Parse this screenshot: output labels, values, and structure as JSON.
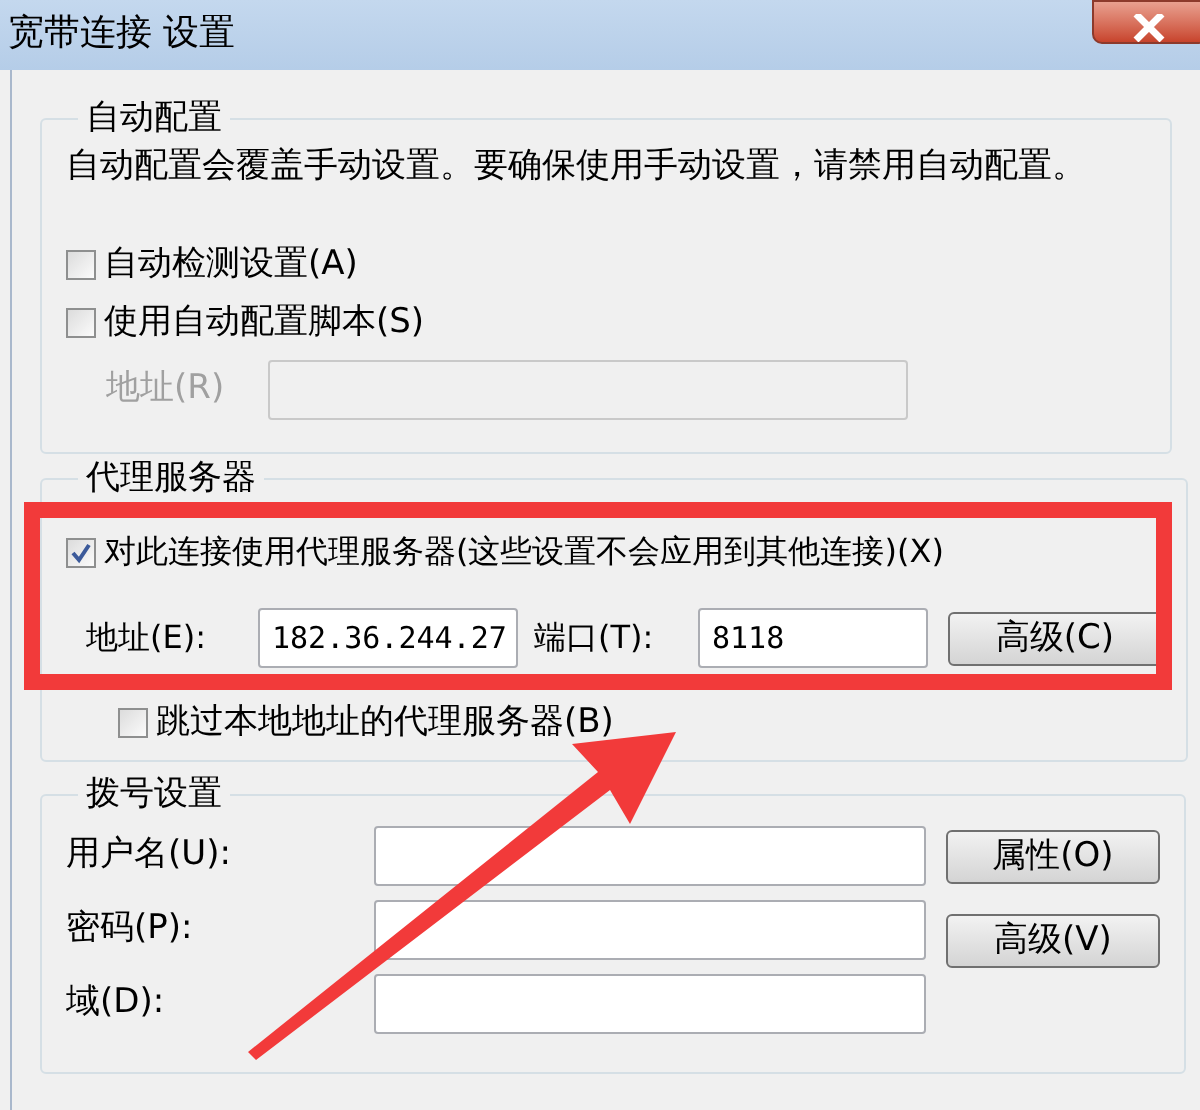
{
  "window": {
    "title": "宽带连接 设置"
  },
  "auto_config": {
    "title": "自动配置",
    "description": "自动配置会覆盖手动设置。要确保使用手动设置，请禁用自动配置。",
    "options": [
      {
        "label": "自动检测设置(A)",
        "checked": false
      },
      {
        "label": "使用自动配置脚本(S)",
        "checked": false
      }
    ],
    "address": {
      "label": "地址(R)",
      "disabled": true
    }
  },
  "proxy": {
    "title": "代理服务器",
    "use_proxy": {
      "label": "对此连接使用代理服务器(这些设置不会应用到其他连接)(X)",
      "checked": true
    },
    "address": {
      "label": "地址(E):",
      "value": "182.36.244.27"
    },
    "port": {
      "label": "端口(T):",
      "value": "8118"
    },
    "advanced_button": "高级(C)",
    "bypass_local": {
      "label": "跳过本地地址的代理服务器(B)",
      "checked": false
    }
  },
  "dialup": {
    "title": "拨号设置",
    "fields": [
      {
        "label": "用户名(U):"
      },
      {
        "label": "密码(P):"
      },
      {
        "label": "域(D):"
      }
    ],
    "buttons": [
      "属性(O)",
      "高级(V)"
    ]
  }
}
